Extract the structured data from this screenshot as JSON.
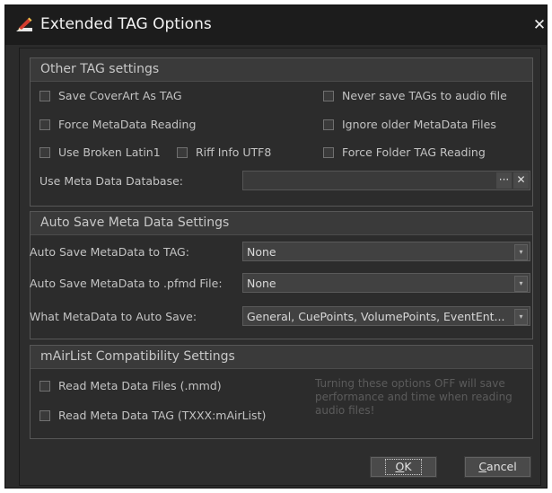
{
  "window": {
    "title": "Extended TAG Options",
    "close_glyph": "✕"
  },
  "other_tag": {
    "header": "Other TAG settings",
    "save_coverart": "Save CoverArt As TAG",
    "never_save": "Never save TAGs to audio file",
    "force_metadata": "Force MetaData Reading",
    "ignore_older": "Ignore older MetaData Files",
    "use_broken_latin1": "Use Broken Latin1",
    "riff_info_utf8": "Riff Info UTF8",
    "force_folder": "Force Folder TAG Reading",
    "meta_db_label": "Use Meta Data Database:",
    "meta_db_value": "",
    "browse_glyph": "···",
    "clear_glyph": "✕"
  },
  "auto_save": {
    "header": "Auto Save Meta Data Settings",
    "to_tag_label": "Auto Save MetaData to TAG:",
    "to_tag_value": "None",
    "to_pfmd_label": "Auto Save MetaData to .pfmd File:",
    "to_pfmd_value": "None",
    "what_label": "What MetaData to Auto Save:",
    "what_value": "General, CuePoints, VolumePoints, EventEnt..."
  },
  "mairlist": {
    "header": "mAirList Compatibility Settings",
    "read_files": "Read Meta Data Files (.mmd)",
    "read_tag": "Read Meta Data TAG (TXXX:mAirList)",
    "note": "Turning these options OFF will save performance and time when reading audio files!"
  },
  "buttons": {
    "ok_u": "O",
    "ok_rest": "K",
    "cancel_u": "C",
    "cancel_rest": "ancel"
  },
  "colors": {
    "background": "#2b2b2b",
    "titlebar": "#1c1c1c",
    "text": "#c8c8c8"
  },
  "icons": {
    "title": "tag-pencil-icon",
    "dropdown": "chevron-down-icon"
  }
}
